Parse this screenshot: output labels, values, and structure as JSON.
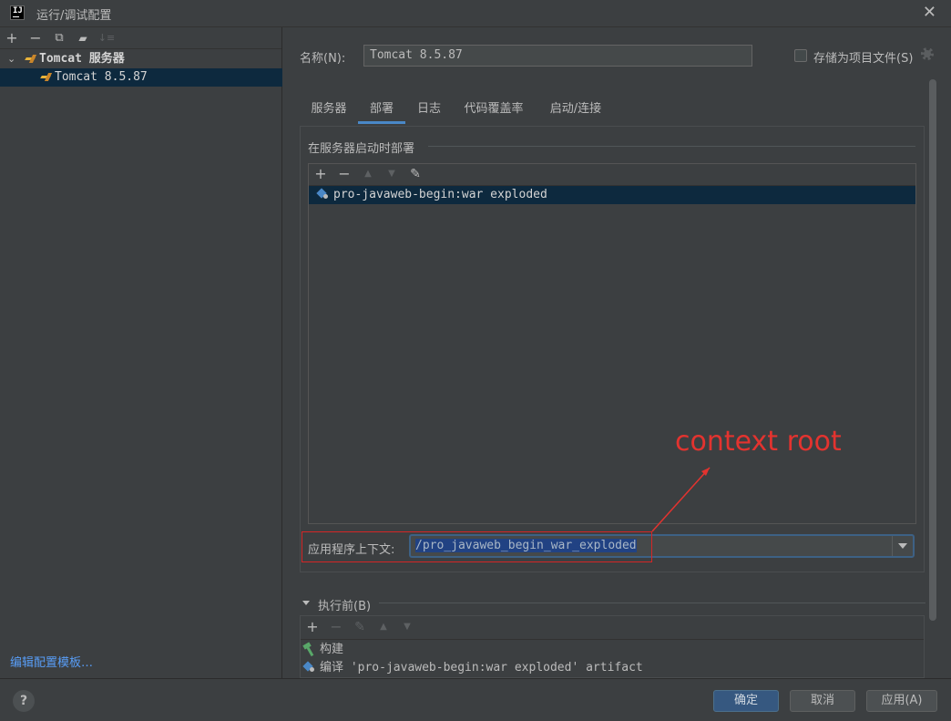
{
  "window": {
    "title": "运行/调试配置",
    "app_icon_text": "IJ"
  },
  "left": {
    "toolbar": [
      "+",
      "−",
      "⧉",
      "▰",
      "↓≡"
    ],
    "tree": [
      {
        "label": "Tomcat 服务器",
        "type": "group"
      },
      {
        "label": "Tomcat 8.5.87",
        "type": "item",
        "selected": true
      }
    ],
    "edit_templates_link": "编辑配置模板…"
  },
  "config": {
    "name_label": "名称(N):",
    "name_value": "Tomcat 8.5.87",
    "store_as_file_label": "存储为项目文件(S)",
    "store_as_file_checked": false,
    "tabs": [
      {
        "label": "服务器",
        "active": false
      },
      {
        "label": "部署",
        "active": true
      },
      {
        "label": "日志",
        "active": false
      },
      {
        "label": "代码覆盖率",
        "active": false
      },
      {
        "label": "启动/连接",
        "active": false
      }
    ],
    "deploy": {
      "section_title": "在服务器启动时部署",
      "toolbar": [
        "+",
        "−",
        "▲",
        "▼",
        "✎"
      ],
      "artifacts": [
        "pro-javaweb-begin:war exploded"
      ],
      "context_label": "应用程序上下文:",
      "context_value": "/pro_javaweb_begin_war_exploded"
    },
    "before_launch": {
      "title": "执行前(B)",
      "toolbar": [
        "+",
        "−",
        "✎",
        "▲",
        "▼"
      ],
      "tasks": [
        {
          "label": "构建",
          "icon": "hammer-icon"
        },
        {
          "label": "编译 'pro-javaweb-begin:war exploded' artifact",
          "icon": "artifact-icon"
        }
      ]
    }
  },
  "annotation": {
    "text": "context root",
    "color": "#e3332f"
  },
  "buttons": {
    "ok": "确定",
    "cancel": "取消",
    "apply": "应用(A)",
    "help": "?"
  },
  "colors": {
    "accent": "#4a88c7",
    "selection": "#0d293e",
    "text_selection": "#214283",
    "annotation_red": "#d52626"
  }
}
